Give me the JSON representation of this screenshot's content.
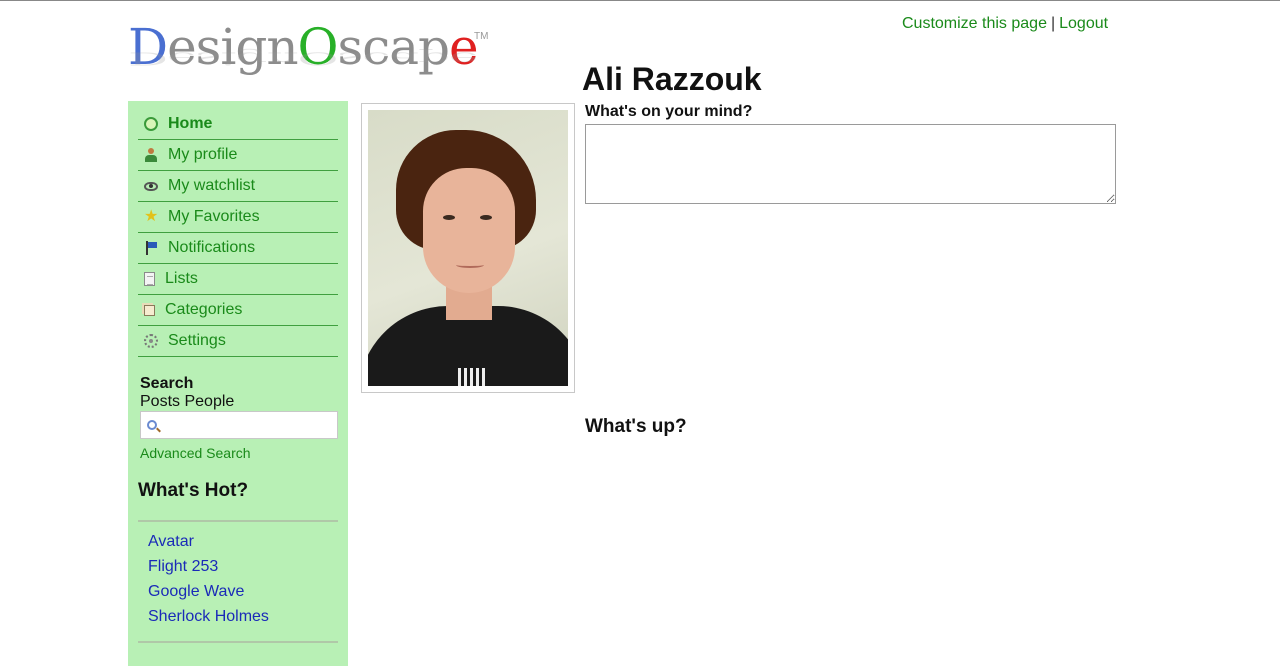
{
  "header": {
    "logo_text_parts": [
      "D",
      "esign",
      "O",
      "scap",
      "e"
    ],
    "logo_tm": "TM",
    "customize_label": "Customize this page",
    "separator": "|",
    "logout_label": "Logout"
  },
  "sidebar": {
    "nav": [
      {
        "label": "Home",
        "icon": "home-icon"
      },
      {
        "label": "My profile",
        "icon": "profile-icon"
      },
      {
        "label": "My watchlist",
        "icon": "eye-icon"
      },
      {
        "label": "My Favorites",
        "icon": "star-icon"
      },
      {
        "label": "Notifications",
        "icon": "flag-icon"
      },
      {
        "label": "Lists",
        "icon": "page-icon"
      },
      {
        "label": "Categories",
        "icon": "categories-icon"
      },
      {
        "label": "Settings",
        "icon": "gear-icon"
      }
    ],
    "search": {
      "title": "Search",
      "tab_posts": "Posts",
      "tab_people": "People",
      "placeholder": "",
      "advanced_label": "Advanced Search"
    },
    "hot": {
      "title": "What's Hot?",
      "items": [
        "Avatar",
        "Flight 253",
        "Google Wave",
        "Sherlock Holmes"
      ]
    }
  },
  "profile": {
    "name": "Ali Razzouk",
    "mind_label": "What's on your mind?",
    "status_value": "",
    "whatsup_label": "What's up?"
  },
  "colors": {
    "sidebar_bg": "#b8f0b5",
    "link_green": "#1a8a1a",
    "link_blue": "#1a2ab8"
  }
}
